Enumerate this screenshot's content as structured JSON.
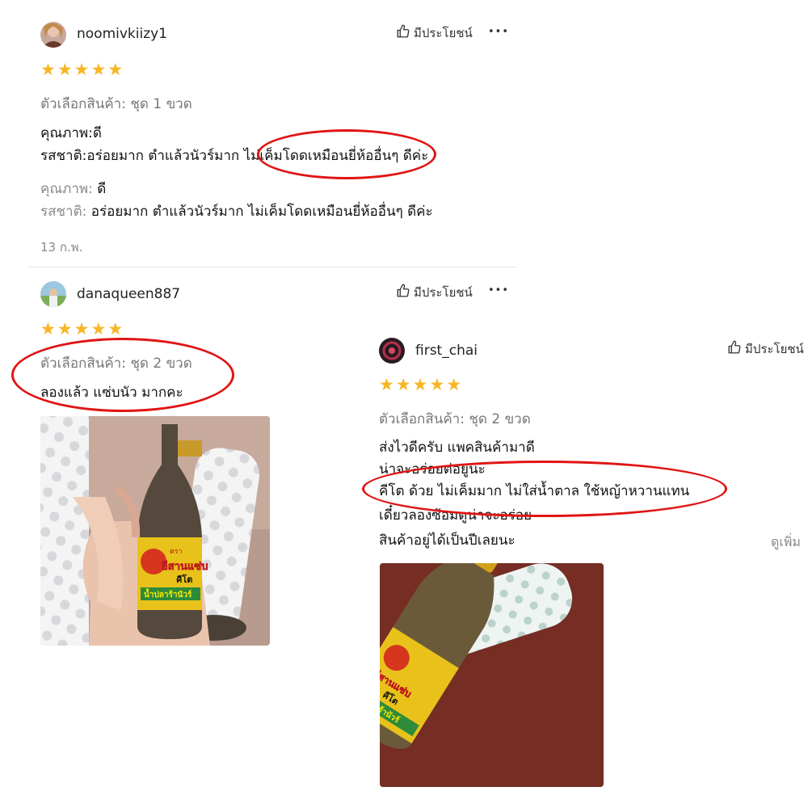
{
  "reviews": [
    {
      "username": "noomivkiizy1",
      "helpful_label": "มีประโยชน์",
      "more_label": "•••",
      "rating": 5,
      "variant": "ตัวเลือกสินค้า: ชุด 1 ขวด",
      "lines": [
        "คุณภาพ:ดี",
        "รสชาติ:อร่อยมาก ตำแล้วนัวร์มาก ไม่เค็มโดดเหมือนยี่ห้ออื่นๆ ดีค่ะ"
      ],
      "details": [
        {
          "label": "คุณภาพ:",
          "value": " ดี"
        },
        {
          "label": "รสชาติ:",
          "value": " อร่อยมาก ตำแล้วนัวร์มาก ไม่เค็มโดดเหมือนยี่ห้ออื่นๆ ดีค่ะ"
        }
      ],
      "date": "13 ก.พ."
    },
    {
      "username": "danaqueen887",
      "helpful_label": "มีประโยชน์",
      "more_label": "•••",
      "rating": 5,
      "variant": "ตัวเลือกสินค้า: ชุด 2 ขวด",
      "lines": [
        "ลองแล้ว แซ่บนัว มากคะ"
      ]
    },
    {
      "username": "first_chai",
      "helpful_label": "มีประโยชน์",
      "rating": 5,
      "variant": "ตัวเลือกสินค้า: ชุด 2 ขวด",
      "lines": [
        "ส่งไวดีครับ แพคสินค้ามาดี",
        "น่าจะอร่อยต่อยูนะ",
        "คีโต ด้วย ไม่เค็มมาก ไม่ใส่น้ำตาล ใช้หญ้าหวานแทน",
        "เดี๋ยวลองซ้อมดูน่าจะอร่อย",
        "สินค้าอยู่ได้เป็นปีเลยนะ"
      ],
      "see_more": "ดูเพิ่ม"
    }
  ],
  "product_label": {
    "brand_small": "ตรา",
    "brand": "อีสานแซ่บ",
    "keto": "คีโต",
    "product": "น้ำปลาร้านัวร์"
  },
  "colors": {
    "star": "#f7b623",
    "annotation": "#e01414",
    "text": "#111111",
    "muted": "#888888"
  },
  "icons": [
    "thumbs-up-icon",
    "more-dots-icon",
    "star-icon"
  ]
}
